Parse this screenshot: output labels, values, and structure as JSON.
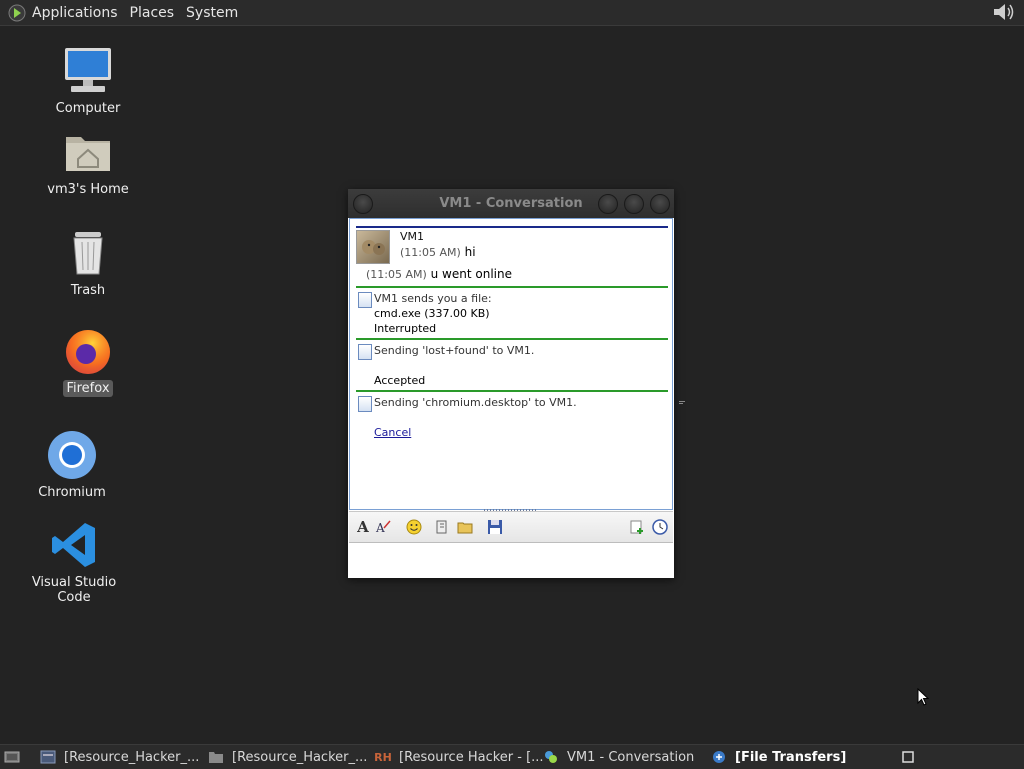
{
  "top_panel": {
    "menus": [
      "Applications",
      "Places",
      "System"
    ]
  },
  "desktop": {
    "icons": [
      {
        "label": "Computer",
        "icon": "computer-icon"
      },
      {
        "label": "vm3's Home",
        "icon": "home-folder-icon"
      },
      {
        "label": "Trash",
        "icon": "trash-icon"
      },
      {
        "label": "Firefox",
        "icon": "firefox-icon"
      },
      {
        "label": "Chromium",
        "icon": "chromium-icon"
      },
      {
        "label": "Visual Studio Code",
        "icon": "vscode-icon"
      }
    ]
  },
  "conversation": {
    "title": "VM1 - Conversation",
    "contact_name": "VM1",
    "msg1_time": "(11:05 AM)",
    "msg1_text": "hi",
    "msg2_time": "(11:05 AM)",
    "msg2_text": "u went online",
    "transfer1_header": "VM1 sends you a file:",
    "transfer1_file": "cmd.exe (337.00 KB)",
    "transfer1_status": "Interrupted",
    "transfer2_header": "Sending 'lost+found' to VM1.",
    "transfer2_status": "Accepted",
    "transfer3_header": "Sending 'chromium.desktop' to VM1.",
    "transfer3_action": "Cancel"
  },
  "taskbar": {
    "items": [
      {
        "label": "[Resource_Hacker_..."
      },
      {
        "label": "[Resource_Hacker_..."
      },
      {
        "label": "[Resource Hacker - [..."
      },
      {
        "label": "VM1 - Conversation"
      },
      {
        "label": "[File Transfers]"
      }
    ],
    "rh_icon_text": "RH"
  },
  "colors": {
    "desktop_bg": "#232323",
    "panel_bg": "#2b2b2b",
    "divider_blue": "#1a2a8a",
    "divider_green": "#2a9a2a",
    "link": "#1a1a9a"
  }
}
